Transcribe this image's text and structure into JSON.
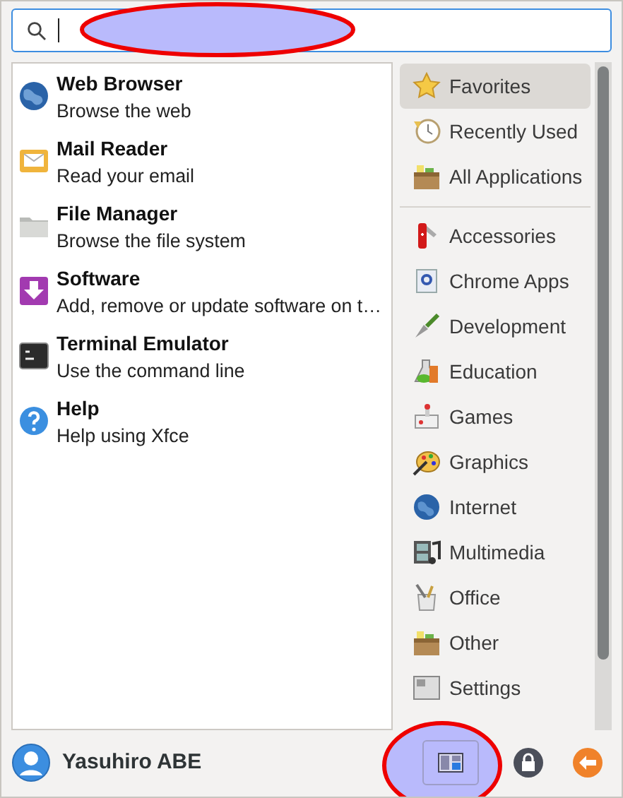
{
  "favorites": [
    {
      "title": "Web Browser",
      "description": "Browse the web"
    },
    {
      "title": "Mail Reader",
      "description": "Read your email"
    },
    {
      "title": "File Manager",
      "description": "Browse the file system"
    },
    {
      "title": "Software",
      "description": "Add, remove or update software on t…"
    },
    {
      "title": "Terminal Emulator",
      "description": "Use the command line"
    },
    {
      "title": "Help",
      "description": "Help using Xfce"
    }
  ],
  "places": [
    {
      "label": "Favorites",
      "selected": true
    },
    {
      "label": "Recently Used",
      "selected": false
    },
    {
      "label": "All Applications",
      "selected": false
    }
  ],
  "categories": [
    {
      "label": "Accessories",
      "selected": false
    },
    {
      "label": "Chrome Apps",
      "selected": false
    },
    {
      "label": "Development",
      "selected": false
    },
    {
      "label": "Education",
      "selected": false
    },
    {
      "label": "Games",
      "selected": false
    },
    {
      "label": "Graphics",
      "selected": false
    },
    {
      "label": "Internet",
      "selected": false
    },
    {
      "label": "Multimedia",
      "selected": false
    },
    {
      "label": "Office",
      "selected": false
    },
    {
      "label": "Other",
      "selected": false
    },
    {
      "label": "Settings",
      "selected": false
    }
  ],
  "user": {
    "name": "Yasuhiro ABE"
  }
}
